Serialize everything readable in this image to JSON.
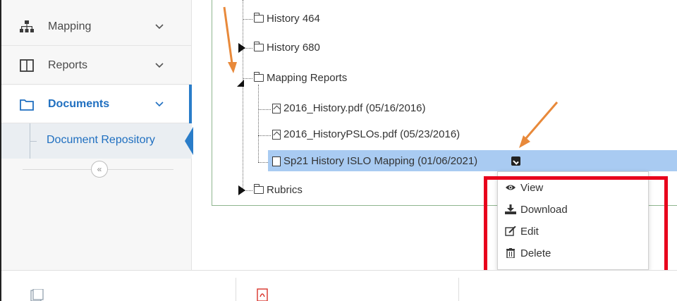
{
  "sidebar": {
    "items": [
      {
        "label": "Mapping",
        "icon": "sitemap-icon"
      },
      {
        "label": "Reports",
        "icon": "columns-icon"
      },
      {
        "label": "Documents",
        "icon": "folder-icon",
        "active": true
      }
    ],
    "sub_item": {
      "label": "Document Repository"
    },
    "collapse_label": "«"
  },
  "tree": {
    "nodes": [
      {
        "label": "History 464",
        "type": "folder",
        "expanded": null
      },
      {
        "label": "History 680",
        "type": "folder",
        "expanded": false
      },
      {
        "label": "Mapping Reports",
        "type": "folder",
        "expanded": true
      },
      {
        "label": "2016_History.pdf (05/16/2016)",
        "type": "pdf"
      },
      {
        "label": "2016_HistoryPSLOs.pdf (05/23/2016)",
        "type": "pdf"
      },
      {
        "label": "Sp21 History ISLO Mapping (01/06/2021)",
        "type": "doc",
        "selected": true
      },
      {
        "label": "Rubrics",
        "type": "folder",
        "expanded": false
      }
    ]
  },
  "context_menu": {
    "items": [
      {
        "label": "View",
        "icon": "eye-icon"
      },
      {
        "label": "Download",
        "icon": "download-icon"
      },
      {
        "label": "Edit",
        "icon": "edit-icon"
      },
      {
        "label": "Delete",
        "icon": "trash-icon"
      }
    ]
  },
  "colors": {
    "accent": "#1f6fc0",
    "selection": "#a9cbf2",
    "highlight_box": "#e8001c",
    "annotation_arrow": "#e8893a"
  }
}
